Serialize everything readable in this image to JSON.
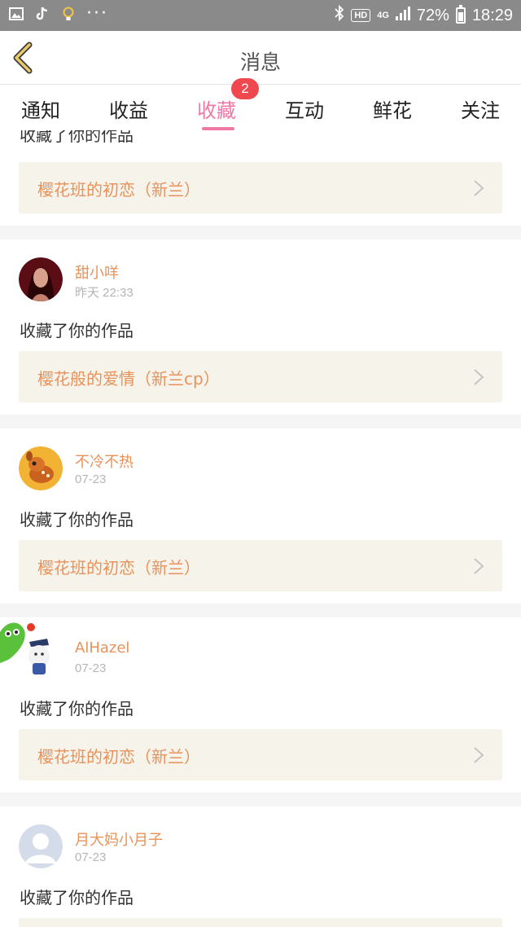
{
  "status_bar": {
    "battery": "72%",
    "time": "18:29",
    "hd": "HD",
    "network": "4G",
    "overflow": "···"
  },
  "header": {
    "title": "消息"
  },
  "tabs": [
    {
      "label": "通知"
    },
    {
      "label": "收益"
    },
    {
      "label": "收藏",
      "active": true,
      "badge": "2"
    },
    {
      "label": "互动"
    },
    {
      "label": "鲜花"
    },
    {
      "label": "关注"
    }
  ],
  "items": [
    {
      "action": "收藏了你的作品",
      "work": "樱花班的初恋（新兰）"
    },
    {
      "user": "甜小咩",
      "time": "昨天 22:33",
      "action": "收藏了你的作品",
      "work": "樱花般的爱情（新兰cp）"
    },
    {
      "user": "不冷不热",
      "time": "07-23",
      "action": "收藏了你的作品",
      "work": "樱花班的初恋（新兰）"
    },
    {
      "user": "AlHazel",
      "time": "07-23",
      "action": "收藏了你的作品",
      "work": "樱花班的初恋（新兰）"
    },
    {
      "user": "月大妈小月子",
      "time": "07-23",
      "action": "收藏了你的作品",
      "work": ""
    }
  ],
  "colors": {
    "accent": "#ef78a5",
    "name": "#e8925a",
    "badge": "#f0484f",
    "work_bg": "#f5f3ea"
  },
  "icons": [
    "gallery-icon",
    "tiktok-icon",
    "bulb-icon",
    "bluetooth-icon",
    "signal-icon",
    "battery-icon",
    "back-chevron-icon",
    "chevron-right-icon"
  ]
}
